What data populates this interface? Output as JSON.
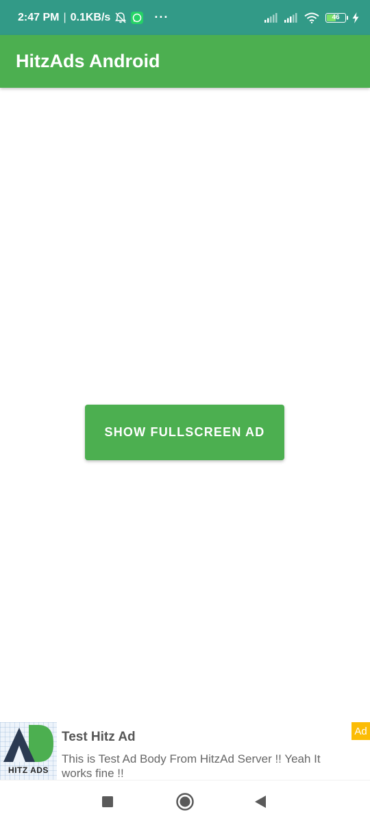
{
  "status_bar": {
    "time": "2:47 PM",
    "separator": "|",
    "speed": "0.1KB/s",
    "more": "···",
    "battery_level": "46",
    "icons": [
      "alarm-off-icon",
      "whatsapp-icon",
      "signal-icon",
      "signal-icon",
      "wifi-icon",
      "battery-icon",
      "charging-icon"
    ]
  },
  "app_bar": {
    "title": "HitzAds Android"
  },
  "main": {
    "show_fullscreen_ad_label": "SHOW FULLSCREEN AD"
  },
  "ad_banner": {
    "logo_text": "HITZ ADS",
    "title": "Test Hitz Ad",
    "body": "This is Test Ad Body From HitzAd Server !! Yeah It works fine !!",
    "badge": "Ad"
  },
  "nav_bar": {
    "icons": [
      "recents-icon",
      "home-icon",
      "back-icon"
    ]
  },
  "colors": {
    "status_bar": "#329a87",
    "primary": "#4caf50",
    "ad_badge": "#fbbc05"
  }
}
